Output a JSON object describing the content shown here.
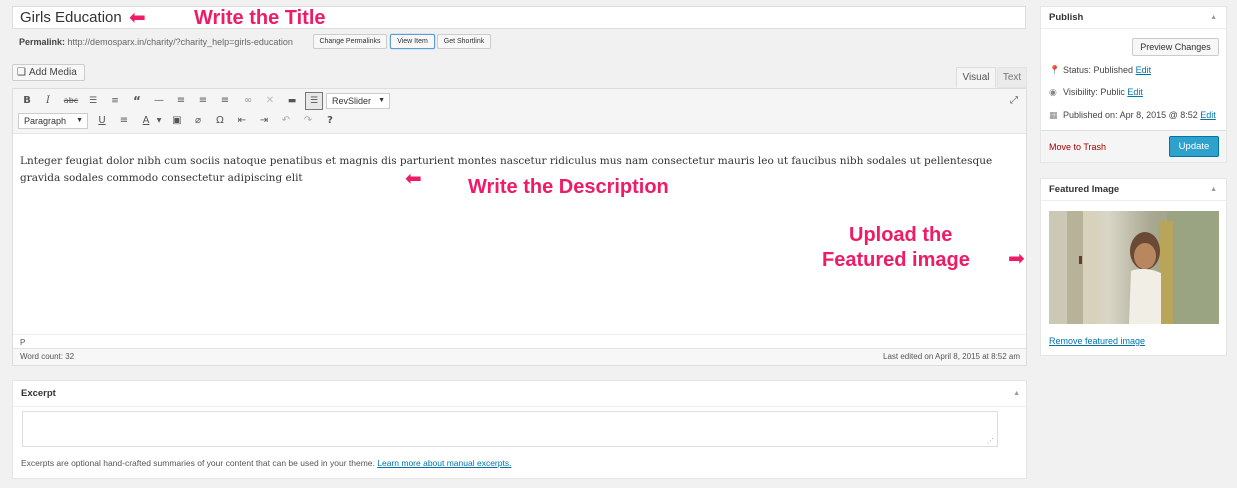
{
  "title": {
    "value": "Girls Education",
    "annotation": "Write the Title"
  },
  "permalink": {
    "label": "Permalink:",
    "url": "http://demosparx.in/charity/?charity_help=girls-education",
    "buttons": [
      "Change Permalinks",
      "View Item",
      "Get Shortlink"
    ]
  },
  "media": {
    "add_label": "Add Media"
  },
  "tabs": {
    "visual": "Visual",
    "text": "Text"
  },
  "toolbar": {
    "row1_icons": [
      "bold-icon",
      "italic-icon",
      "strikethrough-icon",
      "bullet-list-icon",
      "numbered-list-icon",
      "blockquote-icon",
      "horizontal-rule-icon",
      "align-left-icon",
      "align-center-icon",
      "align-right-icon",
      "insert-link-icon",
      "remove-link-icon",
      "read-more-icon",
      "toolbar-toggle-icon"
    ],
    "revslider": "RevSlider",
    "format_select": "Paragraph",
    "row2_icons": [
      "underline-icon",
      "justify-icon",
      "text-color-icon",
      "paste-text-icon",
      "clear-formatting-icon",
      "special-character-icon",
      "outdent-icon",
      "indent-icon",
      "undo-icon",
      "redo-icon",
      "help-icon"
    ]
  },
  "editor": {
    "content": "Lnteger feugiat dolor nibh cum sociis natoque penatibus et magnis dis parturient montes nascetur ridiculus mus nam consectetur mauris leo ut faucibus nibh sodales ut pellentesque gravida sodales commodo consectetur adipiscing elit",
    "annotation": "Write the Description",
    "path": "P",
    "word_count": "Word count: 32",
    "last_edited": "Last edited on April 8, 2015 at 8:52 am"
  },
  "excerpt": {
    "title": "Excerpt",
    "value": "",
    "help": "Excerpts are optional hand-crafted summaries of your content that can be used in your theme.",
    "help_link": "Learn more about manual excerpts."
  },
  "publish": {
    "title": "Publish",
    "preview": "Preview Changes",
    "status_label": "Status:",
    "status_value": "Published",
    "visibility_label": "Visibility:",
    "visibility_value": "Public",
    "published_label": "Published on:",
    "published_value": "Apr 8, 2015 @ 8:52",
    "edit": "Edit",
    "trash": "Move to Trash",
    "update": "Update"
  },
  "featured": {
    "title": "Featured Image",
    "annotation_line1": "Upload the",
    "annotation_line2": "Featured image",
    "remove": "Remove featured image"
  },
  "colors": {
    "annotation": "#ef1b67",
    "update_button": "#2ea2cc",
    "link": "#0073aa",
    "trash": "#aa0000"
  }
}
